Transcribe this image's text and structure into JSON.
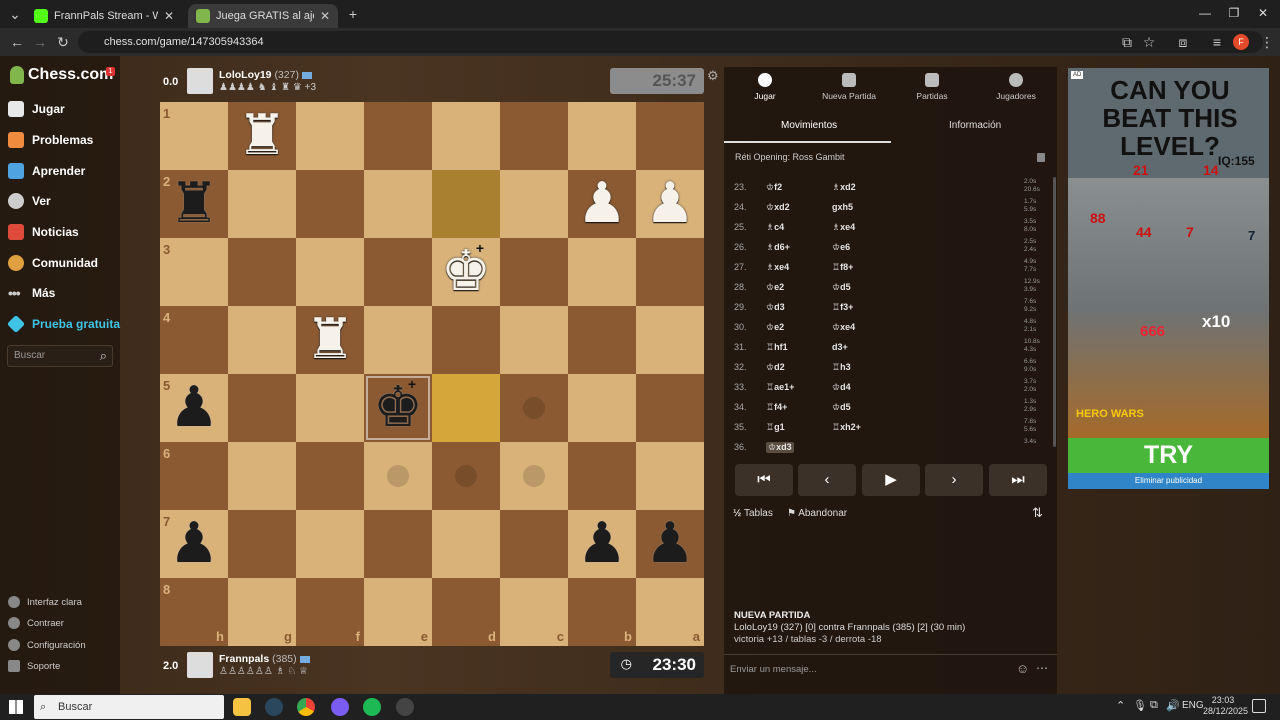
{
  "browser": {
    "tabs": [
      {
        "title": "FrannPals Stream - Watch Live",
        "favicon_color": "#53fc18"
      },
      {
        "title": "Juega GRATIS al ajedrez online",
        "favicon_color": "#81b64c"
      }
    ],
    "url": "chess.com/game/147305943364",
    "profile_initial": "F"
  },
  "sidebar": {
    "logo": "Chess.com",
    "badge": "1",
    "items": [
      {
        "label": "Jugar",
        "icon": "play-icon",
        "color": "#e8e8e8"
      },
      {
        "label": "Problemas",
        "icon": "puzzle-icon",
        "color": "#f08a3c"
      },
      {
        "label": "Aprender",
        "icon": "learn-icon",
        "color": "#4fa3e0"
      },
      {
        "label": "Ver",
        "icon": "binoculars-icon",
        "color": "#cccccc"
      },
      {
        "label": "Noticias",
        "icon": "news-icon",
        "color": "#e04a3c"
      },
      {
        "label": "Comunidad",
        "icon": "community-icon",
        "color": "#e0a040"
      },
      {
        "label": "Más",
        "icon": "more-icon",
        "color": "#cccccc"
      },
      {
        "label": "Prueba gratuita",
        "icon": "diamond-icon",
        "color": "#3fc4e6"
      }
    ],
    "search_placeholder": "Buscar",
    "footer": [
      "Interfaz clara",
      "Contraer",
      "Configuración",
      "Soporte"
    ]
  },
  "game": {
    "top_player": {
      "eval": "0.0",
      "name": "LoloLoy19",
      "rating": "(327)",
      "captured": "♟♟♟♟ ♞ ♝ ♜ ♛ +3",
      "clock": "25:37"
    },
    "bottom_player": {
      "eval": "2.0",
      "name": "Frannpals",
      "rating": "(385)",
      "captured": "♙♙♙♙♙♙ ♗ ♘ ♕",
      "clock": "23:30"
    }
  },
  "panel": {
    "tabs": [
      "Jugar",
      "Nueva Partida",
      "Partidas",
      "Jugadores"
    ],
    "subtabs": [
      "Movimientos",
      "Información"
    ],
    "opening": "Réti Opening: Ross Gambit",
    "moves": [
      {
        "n": "23.",
        "w": "♔f2",
        "b": "♗xd2",
        "t": "2.0s 20.6s"
      },
      {
        "n": "24.",
        "w": "♔xd2",
        "b": "gxh5",
        "t": "1.7s 5.9s"
      },
      {
        "n": "25.",
        "w": "♗c4",
        "b": "♗xe4",
        "t": "3.5s 8.0s"
      },
      {
        "n": "26.",
        "w": "♗d6+",
        "b": "♔e6",
        "t": "2.5s 2.4s"
      },
      {
        "n": "27.",
        "w": "♗xe4",
        "b": "♖f8+",
        "t": "4.9s 7.7s"
      },
      {
        "n": "28.",
        "w": "♔e2",
        "b": "♔d5",
        "t": "12.9s 3.9s"
      },
      {
        "n": "29.",
        "w": "♔d3",
        "b": "♖f3+",
        "t": "7.6s 9.2s"
      },
      {
        "n": "30.",
        "w": "♔e2",
        "b": "♔xe4",
        "t": "4.8s 2.1s"
      },
      {
        "n": "31.",
        "w": "♖hf1",
        "b": "d3+",
        "t": "10.8s 4.3s"
      },
      {
        "n": "32.",
        "w": "♔d2",
        "b": "♖h3",
        "t": "6.6s 9.0s"
      },
      {
        "n": "33.",
        "w": "♖ae1+",
        "b": "♔d4",
        "t": "3.7s 2.0s"
      },
      {
        "n": "34.",
        "w": "♖f4+",
        "b": "♔d5",
        "t": "1.3s 2.9s"
      },
      {
        "n": "35.",
        "w": "♖g1",
        "b": "♖xh2+",
        "t": "7.8s 5.6s"
      },
      {
        "n": "36.",
        "w": "♔xd3",
        "b": "",
        "t": "3.4s"
      }
    ],
    "controls": [
      "⏮",
      "‹",
      "▶",
      "›",
      "⏭"
    ],
    "draw_label": "Tablas",
    "resign_label": "Abandonar",
    "new_game_heading": "NUEVA PARTIDA",
    "new_game_line": "LoloLoy19 (327) [0] contra Frannpals (385) [2] (30 min)",
    "stats_line": "victoria +13 / tablas -3 / derrota -18",
    "chat_placeholder": "Enviar un mensaje..."
  },
  "ad": {
    "ad_label": "AD",
    "headline": "CAN YOU BEAT THIS LEVEL?",
    "iq": "IQ:155",
    "numbers": [
      "21",
      "14",
      "88",
      "44",
      "7",
      "7",
      "666",
      "x10"
    ],
    "logo": "HERO WARS",
    "cta": "TRY",
    "remove": "Eliminar publicidad"
  },
  "taskbar": {
    "search": "Buscar",
    "lang": "ENG",
    "time": "23:03",
    "date": "28/12/2025"
  }
}
